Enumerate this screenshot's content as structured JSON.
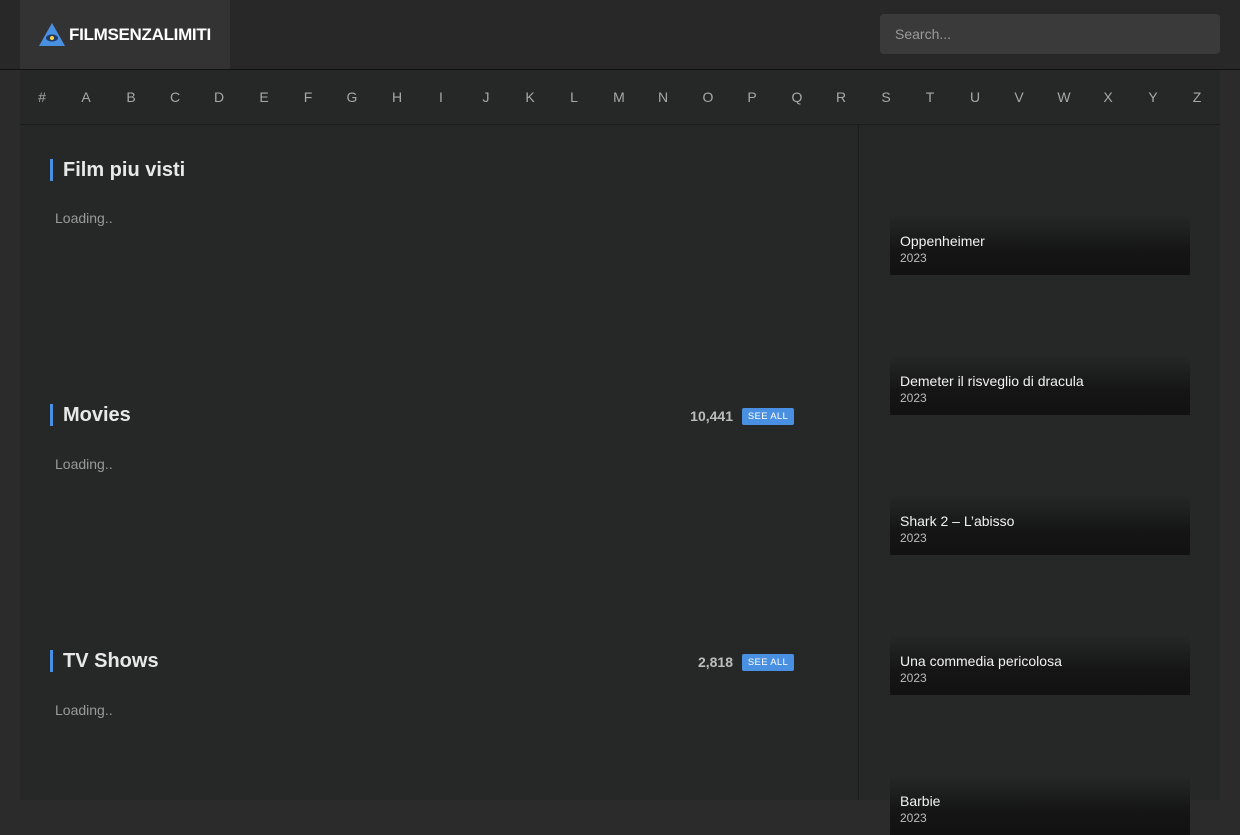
{
  "header": {
    "logo_text": "FILMSENZALIMITI",
    "search_placeholder": "Search...",
    "accent_color": "#4a90e2"
  },
  "alphabet": [
    "#",
    "A",
    "B",
    "C",
    "D",
    "E",
    "F",
    "G",
    "H",
    "I",
    "J",
    "K",
    "L",
    "M",
    "N",
    "O",
    "P",
    "Q",
    "R",
    "S",
    "T",
    "U",
    "V",
    "W",
    "X",
    "Y",
    "Z"
  ],
  "sections": {
    "popular": {
      "title": "Film piu visti",
      "loading": "Loading.."
    },
    "movies": {
      "title": "Movies",
      "count": "10,441",
      "see_all": "SEE ALL",
      "loading": "Loading.."
    },
    "tv": {
      "title": "TV Shows",
      "count": "2,818",
      "see_all": "SEE ALL",
      "loading": "Loading.."
    }
  },
  "sidebar": {
    "items": [
      {
        "title": "Oppenheimer",
        "year": "2023"
      },
      {
        "title": "Demeter il risveglio di dracula",
        "year": "2023"
      },
      {
        "title": "Shark 2 – L’abisso",
        "year": "2023"
      },
      {
        "title": "Una commedia pericolosa",
        "year": "2023"
      },
      {
        "title": "Barbie",
        "year": "2023"
      }
    ]
  }
}
